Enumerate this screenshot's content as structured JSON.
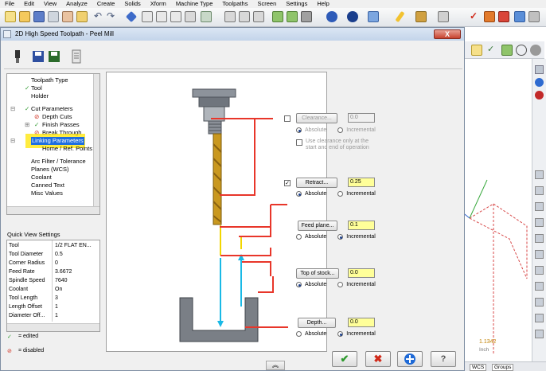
{
  "menu": [
    "File",
    "Edit",
    "View",
    "Analyze",
    "Create",
    "Solids",
    "Xform",
    "Machine Type",
    "Toolpaths",
    "Screen",
    "Settings",
    "Help"
  ],
  "dialog": {
    "title": "2D High Speed Toolpath - Peel Mill",
    "close_label": "X"
  },
  "tree": {
    "items": [
      {
        "label": "Toolpath Type",
        "mark": ""
      },
      {
        "label": "Tool",
        "mark": "✓"
      },
      {
        "label": "Holder",
        "mark": ""
      },
      {
        "label": "Cut Parameters",
        "mark": "✓"
      },
      {
        "label": "Depth Cuts",
        "mark": "⊘"
      },
      {
        "label": "Finish Passes",
        "mark": "✓"
      },
      {
        "label": "Break Through",
        "mark": "⊘"
      },
      {
        "label": "Linking Parameters",
        "mark": ""
      },
      {
        "label": "Home / Ref. Points",
        "mark": ""
      },
      {
        "label": "Arc Filter / Tolerance",
        "mark": ""
      },
      {
        "label": "Planes (WCS)",
        "mark": ""
      },
      {
        "label": "Coolant",
        "mark": ""
      },
      {
        "label": "Canned Text",
        "mark": ""
      },
      {
        "label": "Misc Values",
        "mark": ""
      }
    ]
  },
  "quick_view": {
    "label": "Quick View Settings",
    "rows": [
      {
        "key": "Tool",
        "value": "1/2 FLAT EN..."
      },
      {
        "key": "Tool Diameter",
        "value": "0.5"
      },
      {
        "key": "Corner Radius",
        "value": "0"
      },
      {
        "key": "Feed Rate",
        "value": "3.6672"
      },
      {
        "key": "Spindle Speed",
        "value": "7640"
      },
      {
        "key": "Coolant",
        "value": "On"
      },
      {
        "key": "Tool Length",
        "value": "3"
      },
      {
        "key": "Length Offset",
        "value": "1"
      },
      {
        "key": "Diameter Off...",
        "value": "1"
      }
    ]
  },
  "legend": {
    "edited": "= edited",
    "disabled": "= disabled"
  },
  "params": {
    "clearance": {
      "label": "Clearance...",
      "value": "0.0",
      "absolute": "Absolute",
      "incremental": "Incremental",
      "note": "Use clearance only at the start and end of operation",
      "enabled": false
    },
    "retract": {
      "label": "Retract...",
      "value": "0.25",
      "absolute": "Absolute",
      "incremental": "Incremental",
      "selected": "Absolute"
    },
    "feed_plane": {
      "label": "Feed plane...",
      "value": "0.1",
      "absolute": "Absolute",
      "incremental": "Incremental",
      "selected": "Incremental"
    },
    "top_of_stock": {
      "label": "Top of stock...",
      "value": "0.0",
      "absolute": "Absolute",
      "incremental": "Incremental",
      "selected": "Absolute"
    },
    "depth": {
      "label": "Depth...",
      "value": "0.0",
      "absolute": "Absolute",
      "incremental": "Incremental",
      "selected": "Incremental"
    }
  },
  "status": {
    "value": "1.1342",
    "unit": "Inch",
    "tab1": "WCS",
    "tab2": "Groups"
  },
  "colors": {
    "accent_red": "#e8362a",
    "accent_cyan": "#19b9e6",
    "highlight_yellow": "#ffff99",
    "ok_green": "#2f9a2f",
    "cancel_red": "#d02a1a",
    "help_blue": "#1f6ad6"
  }
}
